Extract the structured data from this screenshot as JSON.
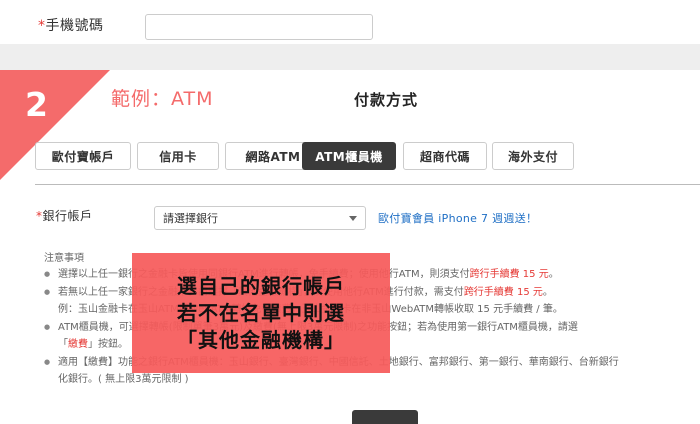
{
  "phone": {
    "required_mark": "*",
    "label": "手機號碼",
    "value": ""
  },
  "step": {
    "number": "2",
    "example_title": "範例：ATM",
    "payment_title": "付款方式"
  },
  "tabs": [
    {
      "label": "歐付寶帳戶"
    },
    {
      "label": "信用卡"
    },
    {
      "label": "網路ATM"
    },
    {
      "label": "ATM櫃員機"
    },
    {
      "label": "超商代碼"
    },
    {
      "label": "海外支付"
    }
  ],
  "bank": {
    "required_mark": "*",
    "label": "銀行帳戶",
    "select_value": "請選擇銀行",
    "promo_link": "歐付寶會員 iPhone 7 週週送！"
  },
  "notice": {
    "title": "注意事項",
    "line1_a": "選擇以上任一銀行之金融卡皆使用同銀行ATM進行轉帳，免手續費；使用他行ATM，則須支付",
    "line1_hl": "跨行手續費 15 元",
    "line1_b": "。",
    "line2_a": "若無以上任一家銀行之金融卡，請選擇「其他金融機構」，須使用他行ATM進行付款，需支付",
    "line2_hl": "跨行手續費 15 元",
    "line2_b": "。",
    "line3": "例：玉山金融卡在玉山ATM或WebATM轉帳免手續費，玉山金融卡在非玉山WebATM轉帳收取 15 元手續費 / 筆。",
    "line4": "ATM櫃員機，可選擇轉帳(限制單筆3萬元)及繳費(無上限3萬元限制)之功能按鈕；若為使用第一銀行ATM櫃員機，請選",
    "line4b_a": "「",
    "line4b_hl": "繳費",
    "line4b_b": "」按鈕。",
    "line5": "適用【繳費】功能之銀行ATM櫃員機：玉山銀行、臺灣銀行、中國信託、土地銀行、富邦銀行、第一銀行、華南銀行、台新銀行",
    "line5b": "化銀行。( 無上限3萬元限制 )"
  },
  "overlay": {
    "line1": "選自己的銀行帳戶",
    "line2": "若不在名單中則選",
    "line3": "「其他金融機構」"
  },
  "colors": {
    "accent": "#f46b6b",
    "link": "#1f6fc5",
    "active_tab": "#3a3a3a",
    "warning": "#e53935"
  }
}
